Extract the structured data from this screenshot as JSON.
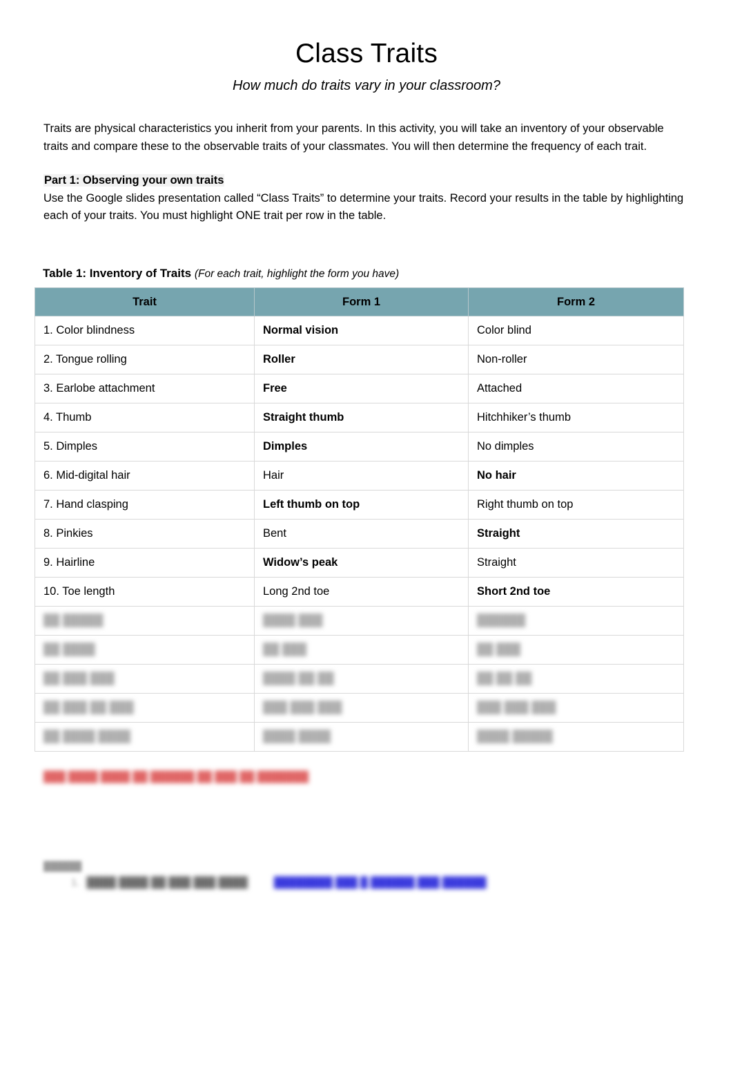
{
  "document": {
    "title": "Class Traits",
    "subtitle": "How much do traits vary in your classroom?",
    "intro_paragraph": "Traits are physical characteristics you inherit from your parents. In this activity, you will take an inventory of your observable traits and compare these to the observable traits of your classmates. You will then determine the frequency of each trait.",
    "part1_heading": "Part 1: Observing your own traits",
    "part1_instructions": "Use the Google slides presentation called “Class Traits” to determine your traits. Record your results in the table by highlighting each of your traits. You must highlight ONE trait per row in the table."
  },
  "table": {
    "caption_bold": "Table 1: Inventory of Traits",
    "caption_italic": "(For each trait, highlight the form you have)",
    "header_bg": "#76a5af",
    "columns": [
      "Trait",
      "Form 1",
      "Form 2"
    ],
    "rows": [
      {
        "trait": "1. Color blindness",
        "form1": "Normal vision",
        "form2": "Color blind",
        "highlighted": "form1"
      },
      {
        "trait": "2. Tongue rolling",
        "form1": "Roller",
        "form2": "Non-roller",
        "highlighted": "form1"
      },
      {
        "trait": "3. Earlobe attachment",
        "form1": "Free",
        "form2": "Attached",
        "highlighted": "form1"
      },
      {
        "trait": "4. Thumb",
        "form1": "Straight thumb",
        "form2": "Hitchhiker’s thumb",
        "highlighted": "form1"
      },
      {
        "trait": "5. Dimples",
        "form1": "Dimples",
        "form2": "No dimples",
        "highlighted": "form1"
      },
      {
        "trait": "6. Mid-digital hair",
        "form1": "Hair",
        "form2": "No hair",
        "highlighted": "form2"
      },
      {
        "trait": "7. Hand clasping",
        "form1": "Left thumb on top",
        "form2": "Right thumb on top",
        "highlighted": "form1"
      },
      {
        "trait": "8. Pinkies",
        "form1": "Bent",
        "form2": "Straight",
        "highlighted": "form2"
      },
      {
        "trait": "9. Hairline",
        "form1": "Widow’s peak",
        "form2": "Straight",
        "highlighted": "form1"
      },
      {
        "trait": "10. Toe length",
        "form1": "Long 2nd toe",
        "form2": "Short 2nd toe",
        "highlighted": "form2"
      }
    ],
    "redacted_rows": [
      {
        "trait": "██ █████",
        "form1": "████ ███",
        "form2": "██████"
      },
      {
        "trait": "██ ████",
        "form1": "██ ███",
        "form2": "██ ███"
      },
      {
        "trait": "██ ███ ███",
        "form1": "████ ██ ██",
        "form2": "██ ██ ██"
      },
      {
        "trait": "██ ███ ██ ███",
        "form1": "███ ███ ███",
        "form2": "███ ███ ███"
      },
      {
        "trait": "██ ████ ████",
        "form1": "████ ████",
        "form2": "████ █████"
      }
    ]
  },
  "note": {
    "red_text": "███ ████ ████ ██ ██████ ██ ███ ██ ███████",
    "red_color": "#e06666"
  },
  "bottom": {
    "heading": "██████",
    "list_marker": "1.",
    "list_text": "████ ████ ██ ███ ███ ████",
    "list_link": "████████ ███ █ ██████ ███ ██████",
    "link_color": "#3b3bdd"
  }
}
